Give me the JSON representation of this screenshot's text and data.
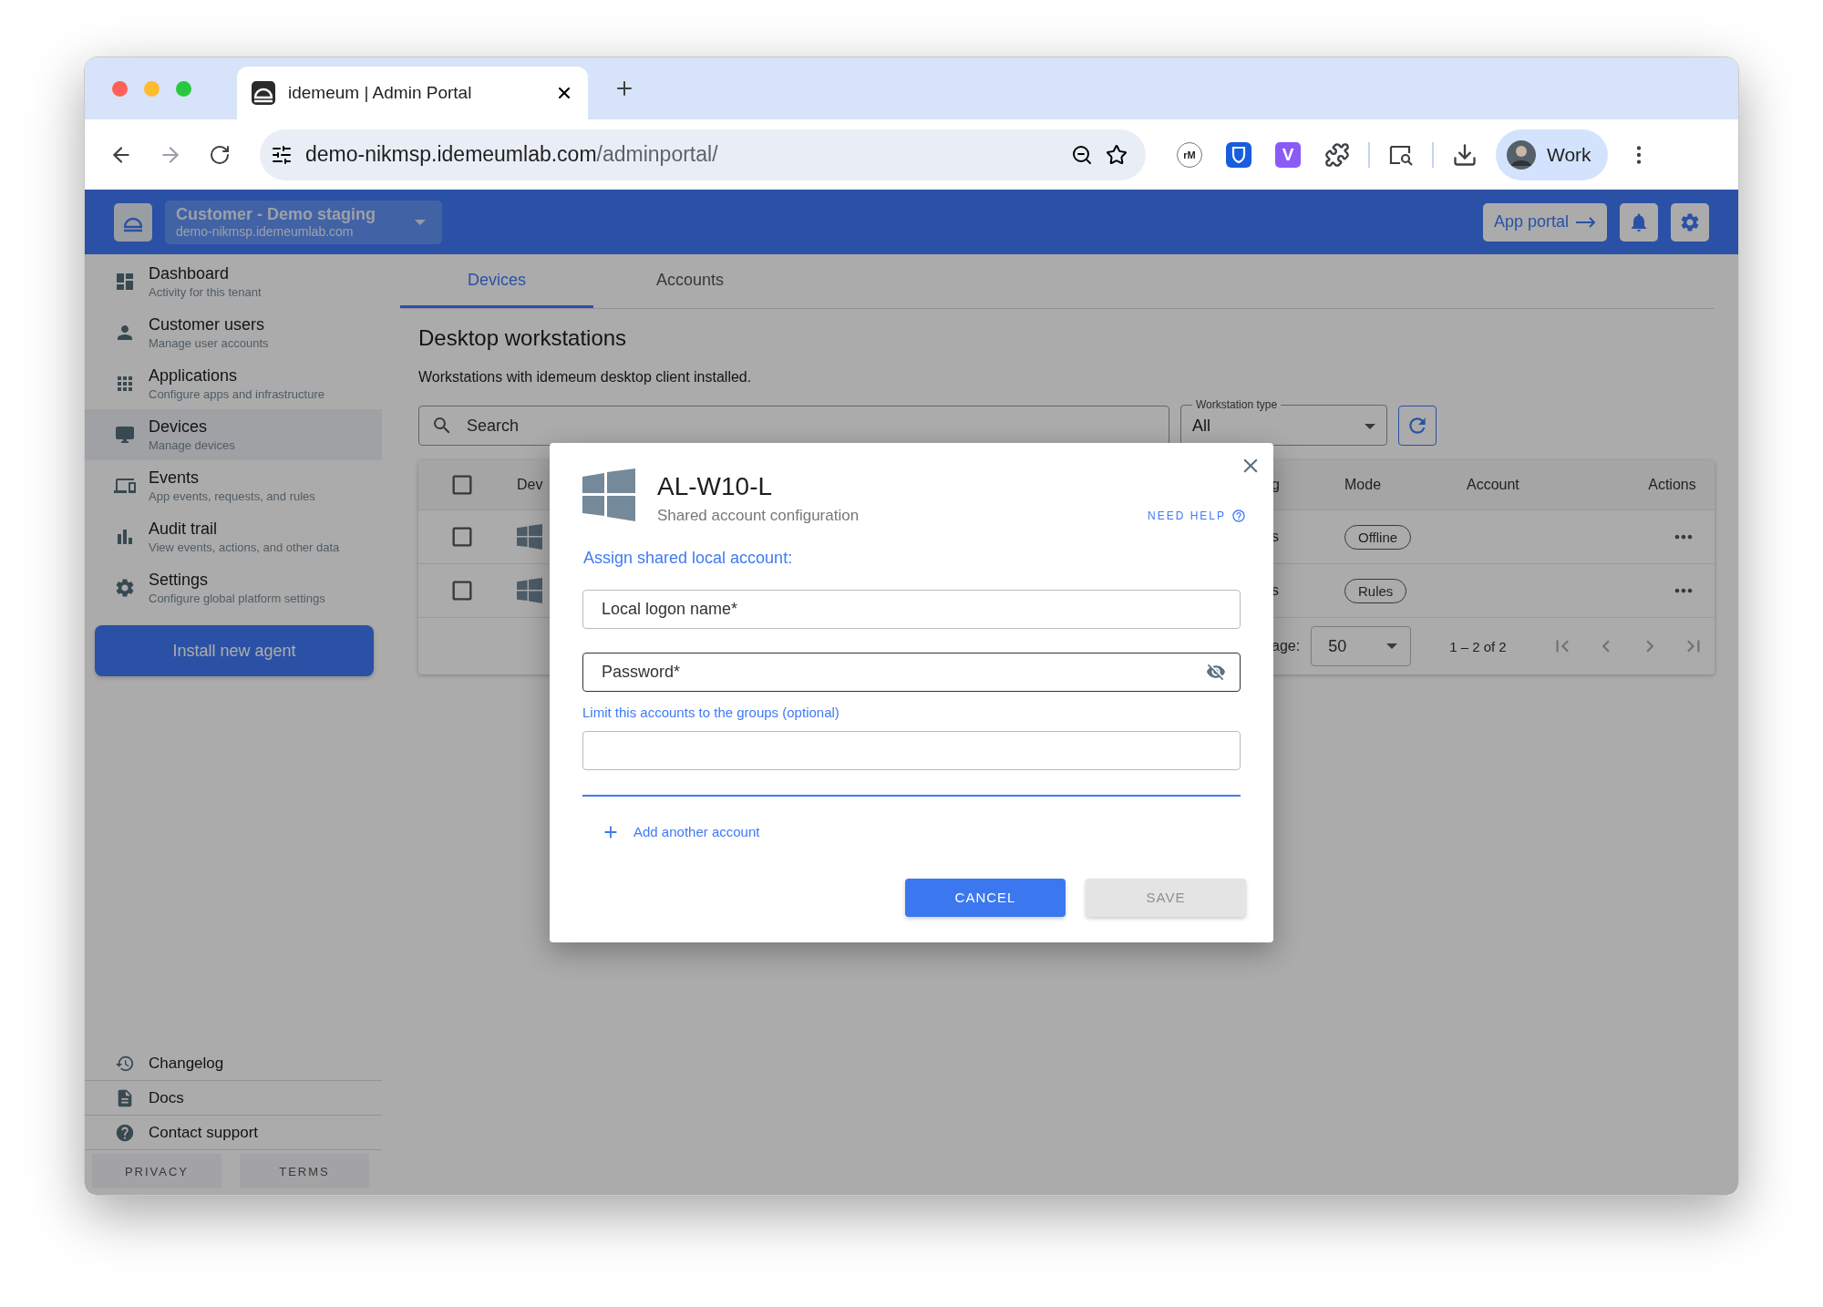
{
  "browser": {
    "tab_title": "idemeum | Admin Portal",
    "url_host": "demo-nikmsp.idemeumlab.com",
    "url_path": "/adminportal/",
    "extensions": [
      {
        "kind": "round",
        "label": "rM"
      },
      {
        "kind": "shield"
      },
      {
        "kind": "square",
        "label": "V"
      },
      {
        "kind": "puzzle"
      }
    ],
    "profile": "Work"
  },
  "header": {
    "tenant_name": "Customer - Demo staging",
    "tenant_domain": "demo-nikmsp.idemeumlab.com",
    "app_portal": "App portal"
  },
  "sidebar": {
    "items": [
      {
        "title": "Dashboard",
        "subtitle": "Activity for this tenant",
        "selected": false
      },
      {
        "title": "Customer users",
        "subtitle": "Manage user accounts",
        "selected": false
      },
      {
        "title": "Applications",
        "subtitle": "Configure apps and infrastructure",
        "selected": false
      },
      {
        "title": "Devices",
        "subtitle": "Manage devices",
        "selected": true
      },
      {
        "title": "Events",
        "subtitle": "App events, requests, and rules",
        "selected": false
      },
      {
        "title": "Audit trail",
        "subtitle": "View events, actions, and other data",
        "selected": false
      },
      {
        "title": "Settings",
        "subtitle": "Configure global platform settings",
        "selected": false
      }
    ],
    "install_button": "Install new agent",
    "footer_links": [
      "Changelog",
      "Docs",
      "Contact support"
    ],
    "legal": [
      "PRIVACY",
      "TERMS"
    ]
  },
  "tabs": [
    {
      "label": "Devices",
      "selected": true
    },
    {
      "label": "Accounts",
      "selected": false
    }
  ],
  "heading": "Desktop workstations",
  "description": "Workstations with idemeum desktop client installed.",
  "search": {
    "placeholder": "Search"
  },
  "filter": {
    "label": "Workstation type",
    "value": "All"
  },
  "table": {
    "header_checked": false,
    "columns": [
      "Dev",
      "g",
      "Mode",
      "Account",
      "Actions"
    ],
    "rows": [
      {
        "checked": false,
        "column_2": "s",
        "mode": "Offline"
      },
      {
        "checked": false,
        "column_2": "s",
        "mode": "Rules"
      }
    ],
    "per_page_label": "age:",
    "per_page": "50",
    "range": "1 – 2 of 2"
  },
  "modal": {
    "title": "AL-W10-L",
    "subtitle": "Shared account configuration",
    "help": "NEED HELP",
    "section": "Assign shared local account:",
    "fields": [
      {
        "kind": "text",
        "placeholder": "Local logon name*",
        "focused": false
      },
      {
        "kind": "password",
        "placeholder": "Password*",
        "focused": true
      }
    ],
    "groups_label": "Limit this accounts to the groups (optional)",
    "add_account": "Add another account",
    "buttons": [
      {
        "kind": "cancel",
        "label": "CANCEL",
        "disabled": false
      },
      {
        "kind": "save",
        "label": "SAVE",
        "disabled": true
      }
    ]
  }
}
